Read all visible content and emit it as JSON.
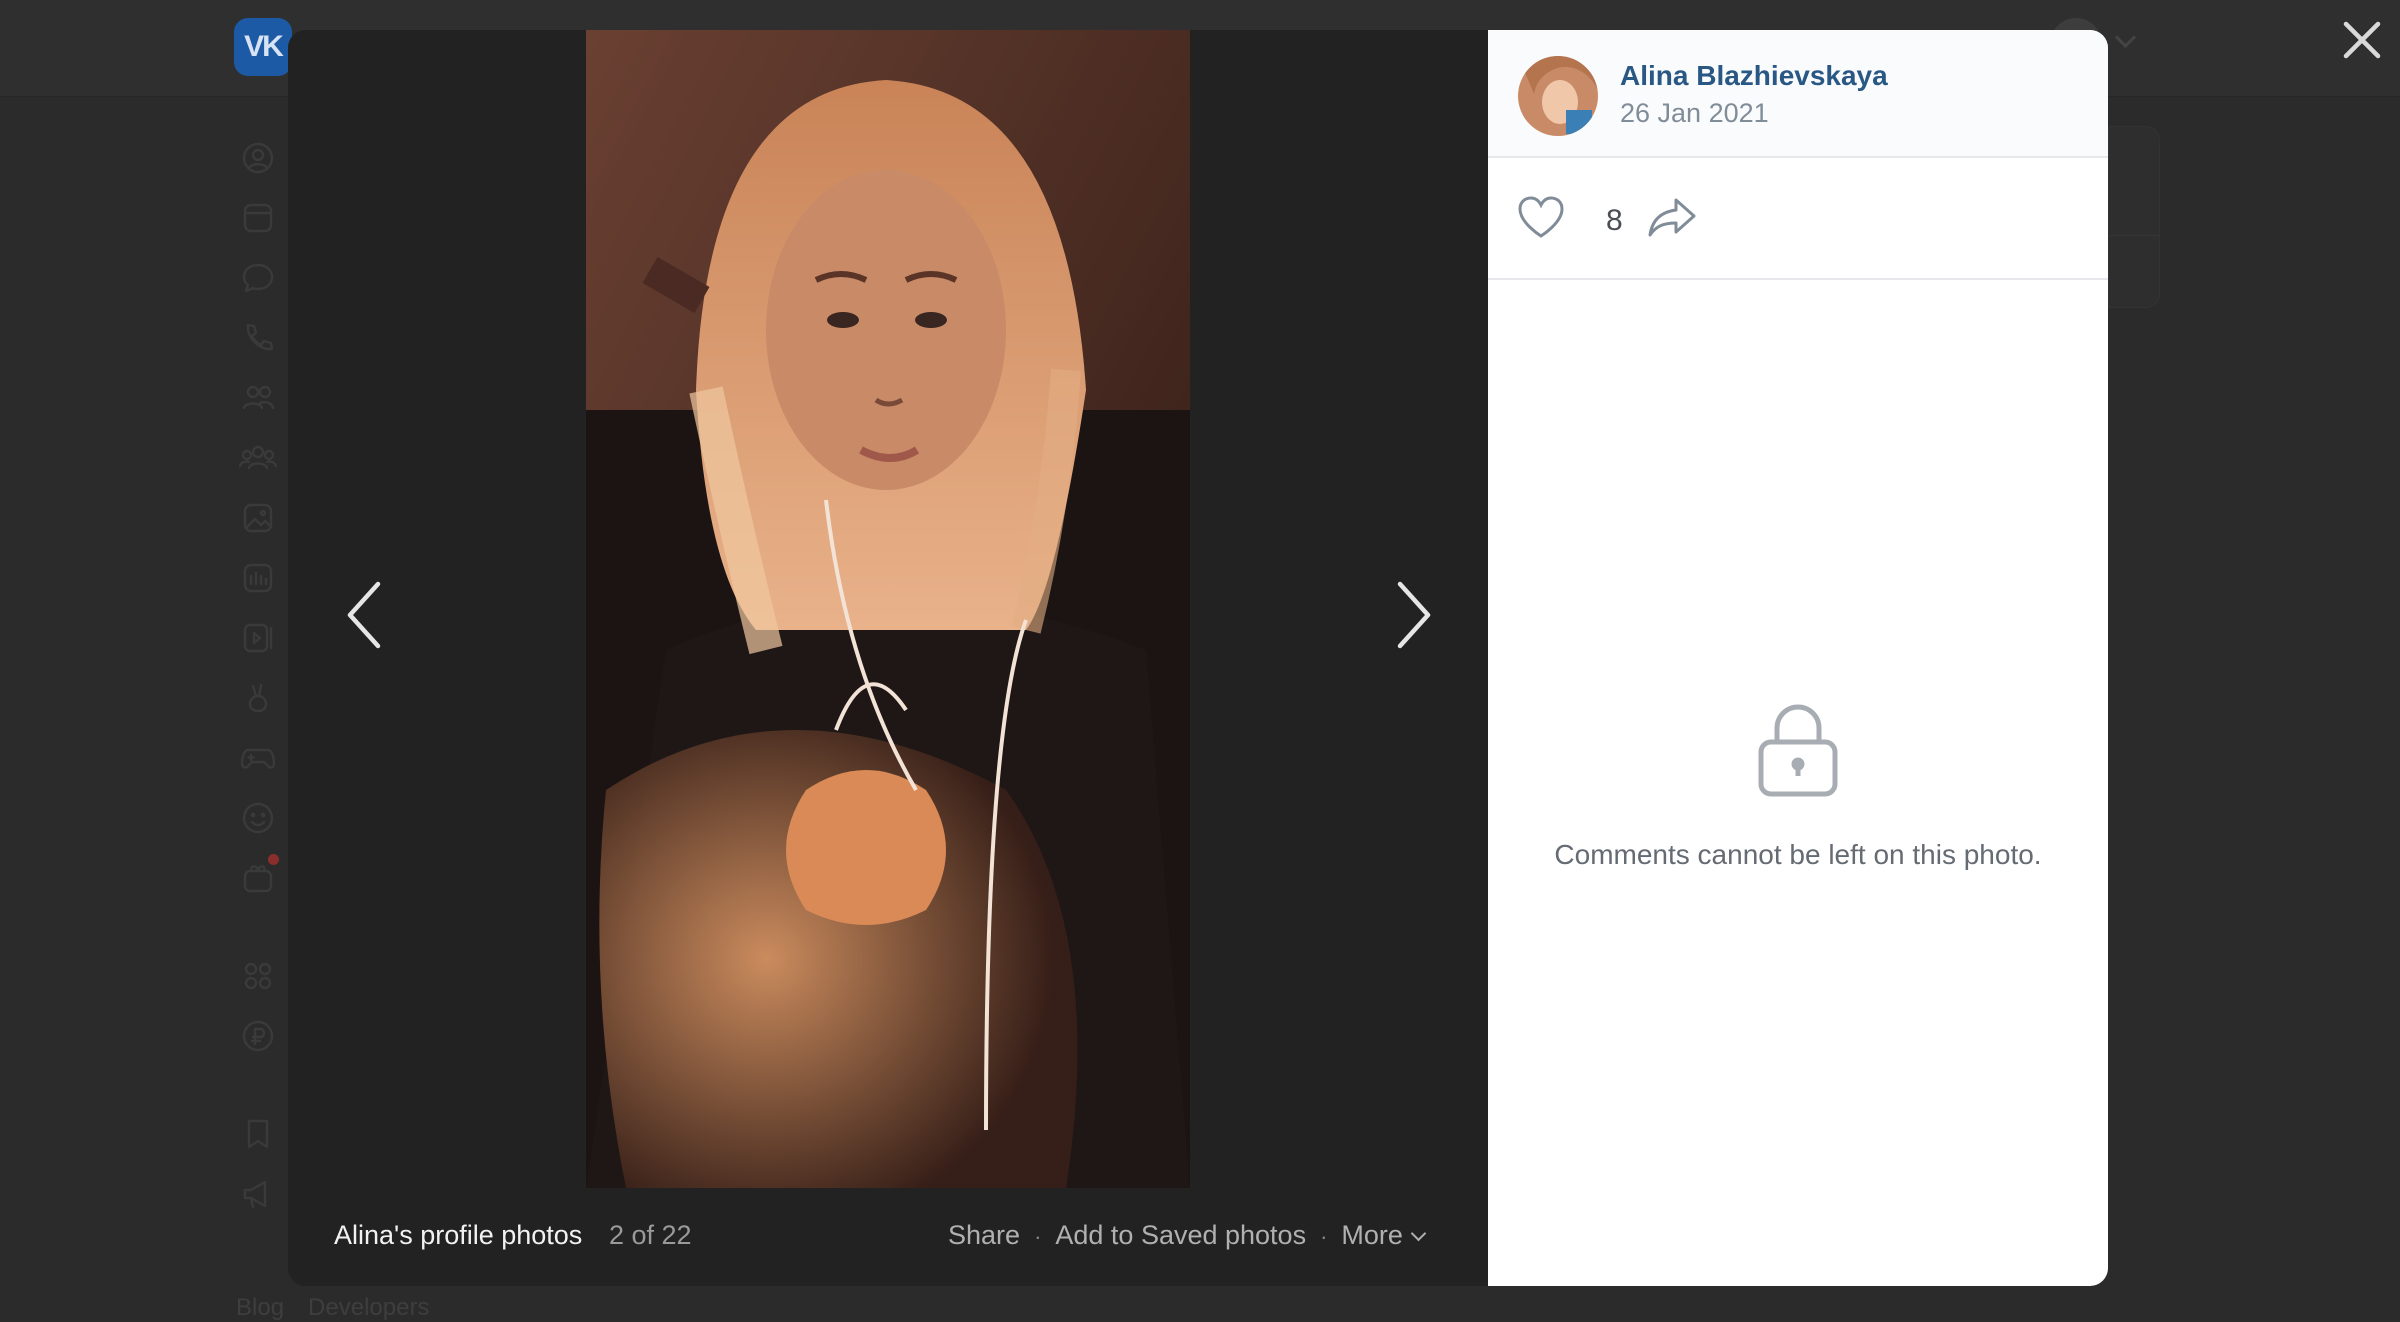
{
  "page": {
    "logo_text": "VK",
    "footer_links": [
      "Blog",
      "Developers"
    ]
  },
  "viewer": {
    "album_title": "Alina's profile photos",
    "counter": "2 of 22",
    "actions": {
      "share": "Share",
      "add_saved": "Add to Saved photos",
      "more": "More"
    },
    "author": {
      "name": "Alina Blazhievskaya",
      "date": "26 Jan 2021"
    },
    "likes": "8",
    "comments_locked_message": "Comments cannot be left on this photo."
  },
  "icons": {
    "close": "close-icon",
    "prev": "chevron-left-icon",
    "next": "chevron-right-icon",
    "like": "heart-icon",
    "share": "share-arrow-icon",
    "lock": "lock-icon"
  },
  "colors": {
    "accent_link": "#2a5885",
    "muted_text": "#818c99",
    "backdrop": "#2b2b2b",
    "viewer_bg": "#232323"
  }
}
